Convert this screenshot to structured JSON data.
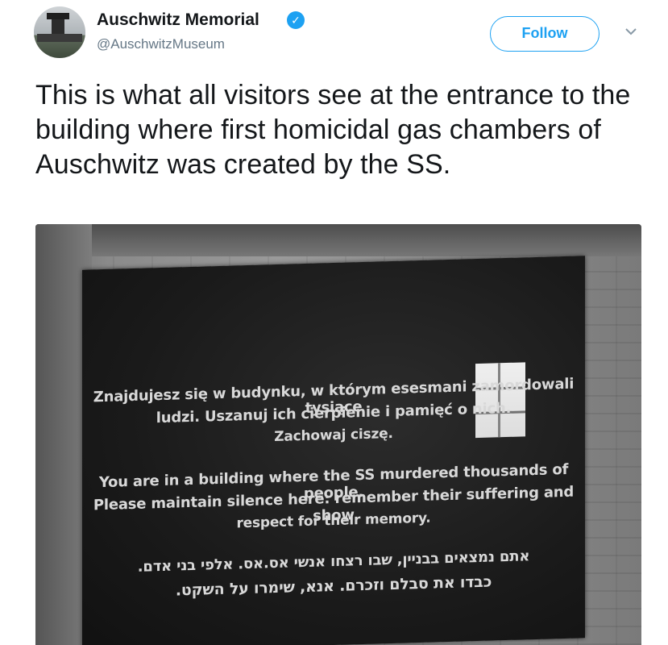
{
  "author": {
    "name": "Auschwitz Memorial",
    "handle": "@AuschwitzMuseum",
    "verified_glyph": "✓"
  },
  "actions": {
    "follow_label": "Follow"
  },
  "tweet": {
    "text": "This is what all visitors see at the entrance to the building where first homicidal gas chambers of Auschwitz was created by the SS."
  },
  "photo": {
    "plaque": {
      "polish": [
        "Znajdujesz się w budynku, w którym esesmani zamordowali tysiące",
        "ludzi. Uszanuj ich cierpienie i pamięć o nich.",
        "Zachowaj ciszę."
      ],
      "english": [
        "You are in a building where the SS murdered thousands of people.",
        "Please maintain silence here: remember their suffering and show",
        "respect for their memory."
      ],
      "hebrew": [
        "אתם נמצאים בבניין, שבו רצחו אנשי אס.אס. אלפי בני אדם.",
        "כבדו את סבלם וזכרם. אנא, שימרו על השקט."
      ]
    }
  },
  "colors": {
    "accent": "#1da1f2",
    "text": "#14171a",
    "muted": "#657786"
  },
  "icons": {
    "caret": "chevron-down-icon",
    "verified": "verified-badge-icon"
  }
}
